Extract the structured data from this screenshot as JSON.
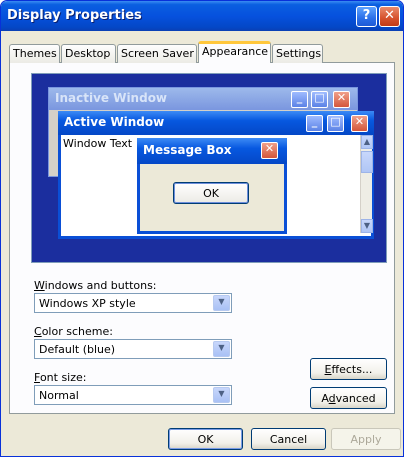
{
  "window": {
    "title": "Display Properties"
  },
  "titlebar": {
    "help_glyph": "?",
    "close_glyph": "✕"
  },
  "tabs": [
    {
      "label": "Themes",
      "active": false
    },
    {
      "label": "Desktop",
      "active": false
    },
    {
      "label": "Screen Saver",
      "active": false
    },
    {
      "label": "Appearance",
      "active": true
    },
    {
      "label": "Settings",
      "active": false
    }
  ],
  "preview": {
    "inactive_title": "Inactive Window",
    "active_title": "Active Window",
    "window_text": "Window Text",
    "message_box_title": "Message Box",
    "message_box_ok": "OK"
  },
  "fields": {
    "windows_buttons": {
      "label_underlined": "W",
      "label_rest": "indows and buttons:",
      "value": "Windows XP style"
    },
    "color_scheme": {
      "label_underlined": "C",
      "label_rest": "olor scheme:",
      "value": "Default (blue)"
    },
    "font_size": {
      "label_underlined": "F",
      "label_rest": "ont size:",
      "value": "Normal"
    }
  },
  "side_buttons": {
    "effects": {
      "underlined": "E",
      "rest": "ffects..."
    },
    "advanced": {
      "pre": "A",
      "underlined": "d",
      "rest": "vanced"
    }
  },
  "footer": {
    "ok": "OK",
    "cancel": "Cancel",
    "apply": "Apply"
  },
  "colors": {
    "titlebar": "#0651de",
    "tab_highlight": "#ffc73c",
    "preview_desktop": "#1b2e9e"
  }
}
